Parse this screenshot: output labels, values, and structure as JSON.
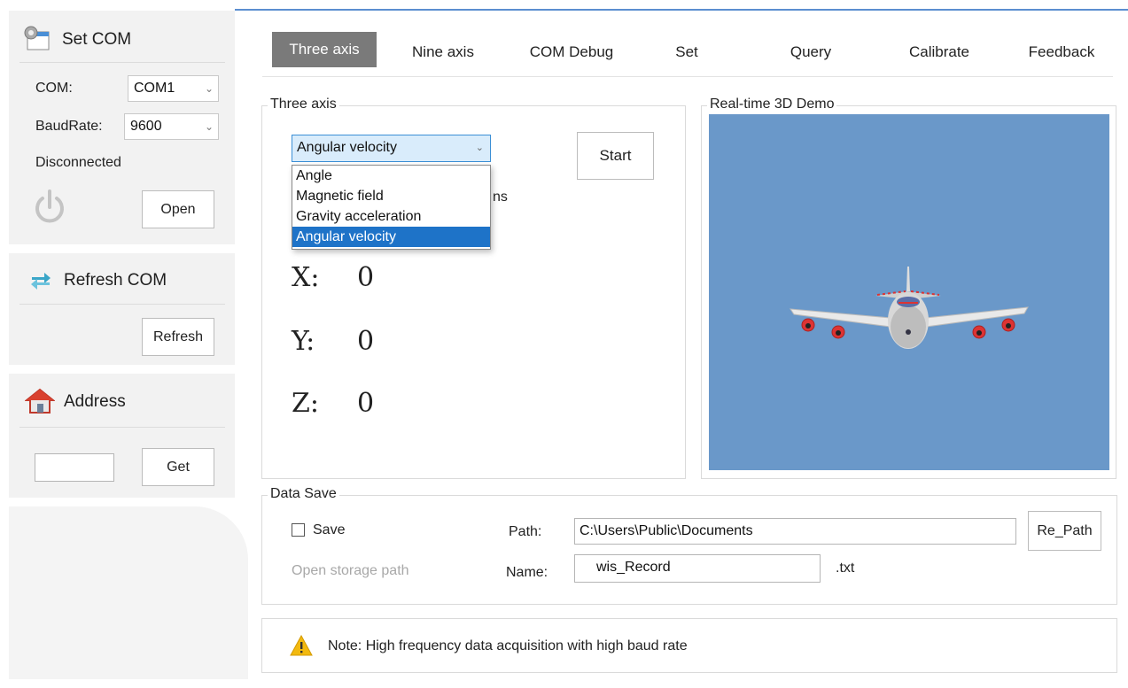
{
  "sidebar": {
    "set_com": {
      "title": "Set COM",
      "com_label": "COM:",
      "com_value": "COM1",
      "baud_label": "BaudRate:",
      "baud_value": "9600",
      "status": "Disconnected",
      "open_button": "Open"
    },
    "refresh": {
      "title": "Refresh COM",
      "refresh_button": "Refresh"
    },
    "address": {
      "title": "Address",
      "input_value": "",
      "get_button": "Get"
    }
  },
  "tabs": [
    {
      "label": "Three axis",
      "active": true
    },
    {
      "label": "Nine axis"
    },
    {
      "label": "COM Debug"
    },
    {
      "label": "Set"
    },
    {
      "label": "Query"
    },
    {
      "label": "Calibrate"
    },
    {
      "label": "Feedback"
    }
  ],
  "three_axis": {
    "group_title": "Three axis",
    "selected_mode": "Angular velocity",
    "options": [
      "Angle",
      "Magnetic field",
      "Gravity acceleration",
      "Angular velocity"
    ],
    "hidden_text_fragment": "ns",
    "start_button": "Start",
    "x_label": "X:",
    "x_value": "0",
    "y_label": "Y:",
    "y_value": "0",
    "z_label": "Z:",
    "z_value": "0"
  },
  "demo": {
    "group_title": "Real-time 3D Demo",
    "background_color": "#6a98c9"
  },
  "data_save": {
    "group_title": "Data Save",
    "save_label": "Save",
    "save_checked": false,
    "open_storage_path": "Open storage path",
    "path_label": "Path:",
    "path_value": "C:\\Users\\Public\\Documents",
    "repath_button": "Re_Path",
    "name_label": "Name:",
    "name_value": "wis_Record",
    "ext": ".txt"
  },
  "note": {
    "text": "Note: High frequency data acquisition with high baud rate"
  },
  "colors": {
    "accent": "#1e73c8",
    "tab_active": "#7a7a7a",
    "warning": "#f2b90f"
  },
  "icons": {
    "set_com": "settings-window-icon",
    "refresh": "refresh-arrows-icon",
    "address": "house-icon",
    "power": "power-icon",
    "warning": "warning-icon"
  }
}
